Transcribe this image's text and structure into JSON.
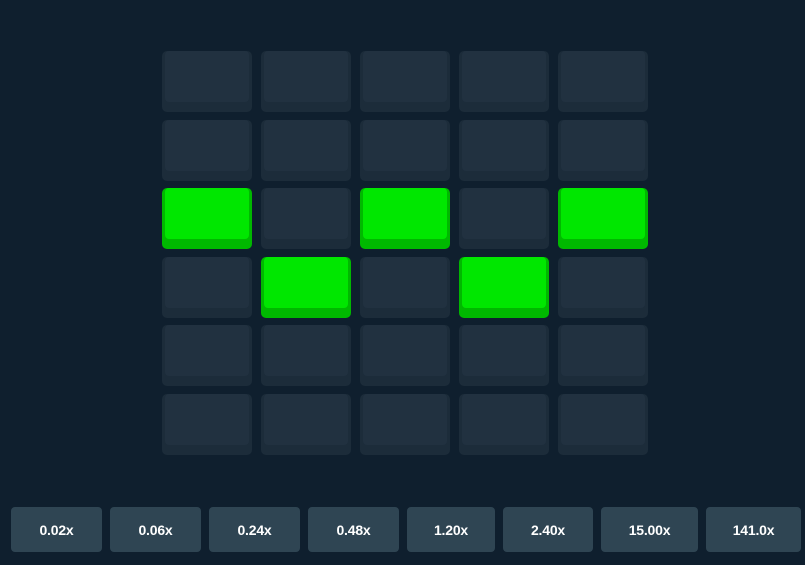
{
  "board": {
    "rows": 6,
    "cols": 5,
    "colors": {
      "tile_base": "#1c2c3a",
      "tile_face": "#213140",
      "active_base": "#00b800",
      "active_face": "#00e700"
    },
    "active_tiles": [
      [
        2,
        0
      ],
      [
        2,
        2
      ],
      [
        2,
        4
      ],
      [
        3,
        1
      ],
      [
        3,
        3
      ]
    ]
  },
  "multipliers": [
    {
      "label": "0.02x"
    },
    {
      "label": "0.06x"
    },
    {
      "label": "0.24x"
    },
    {
      "label": "0.48x"
    },
    {
      "label": "1.20x"
    },
    {
      "label": "2.40x"
    },
    {
      "label": "15.00x"
    },
    {
      "label": "141.0x"
    }
  ],
  "colors": {
    "background": "#0f1f2e",
    "multiplier_bg": "#2f4553",
    "multiplier_text": "#ffffff"
  }
}
